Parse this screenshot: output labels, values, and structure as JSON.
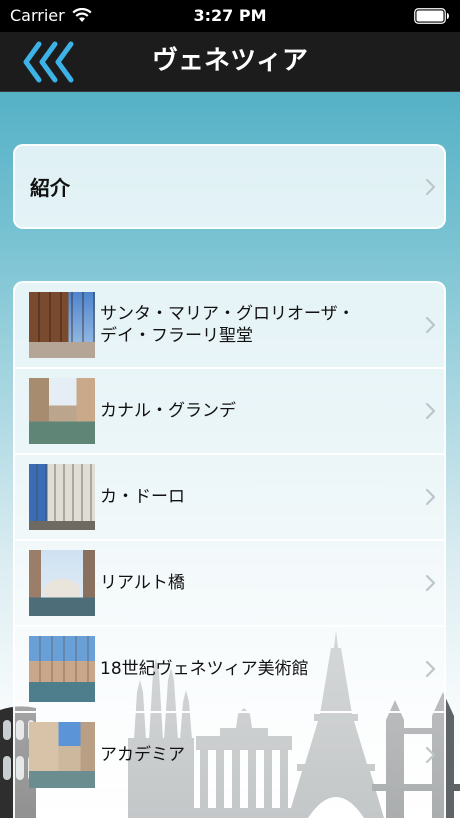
{
  "status_bar": {
    "carrier": "Carrier",
    "time": "3:27 PM",
    "icons": [
      "wifi-icon",
      "battery-icon"
    ]
  },
  "nav": {
    "title": "ヴェネツィア",
    "back_icon": "triple-chevron-left-icon"
  },
  "intro": {
    "label": "紹介",
    "chevron_icon": "chevron-right-icon"
  },
  "places": [
    {
      "label": "サンタ・マリア・グロリオーザ・\nデイ・フラーリ聖堂",
      "chevron_icon": "chevron-right-icon"
    },
    {
      "label": "カナル・グランデ",
      "chevron_icon": "chevron-right-icon"
    },
    {
      "label": "カ・ドーロ",
      "chevron_icon": "chevron-right-icon"
    },
    {
      "label": "リアルト橋",
      "chevron_icon": "chevron-right-icon"
    },
    {
      "label": "18世紀ヴェネツィア美術館",
      "chevron_icon": "chevron-right-icon"
    },
    {
      "label": "アカデミア",
      "chevron_icon": "chevron-right-icon"
    }
  ],
  "colors": {
    "status_bar": "#000000",
    "nav_bar": "#1c1c1c",
    "accent": "#3db2e6",
    "chevron": "#bcc6ca",
    "skyline": "#8f9597",
    "skyline_mid": "#5f6466",
    "skyline_dark": "#2e2e2e"
  }
}
